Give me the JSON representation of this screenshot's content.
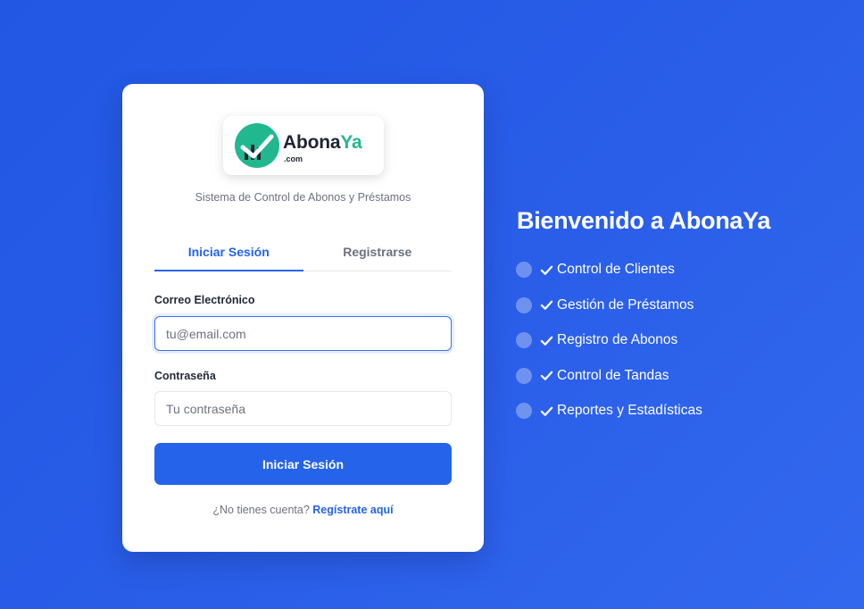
{
  "logo": {
    "name_main": "Abona",
    "name_accent": "Ya",
    "tld": ".com",
    "icon": "logo-chart-check-icon",
    "brand_color": "#22b88f"
  },
  "login": {
    "subtitle": "Sistema de Control de Abonos y Préstamos",
    "tabs": [
      {
        "label": "Iniciar Sesión",
        "active": true
      },
      {
        "label": "Registrarse",
        "active": false
      }
    ],
    "email": {
      "label": "Correo Electrónico",
      "placeholder": "tu@email.com",
      "value": ""
    },
    "password": {
      "label": "Contraseña",
      "placeholder": "Tu contraseña",
      "value": ""
    },
    "submit_label": "Iniciar Sesión",
    "signup_prompt": "¿No tienes cuenta?",
    "signup_link": "Regístrate aquí"
  },
  "welcome": {
    "title": "Bienvenido a AbonaYa",
    "features": [
      "Control de Clientes",
      "Gestión de Préstamos",
      "Registro de Abonos",
      "Control de Tandas",
      "Reportes y Estadísticas"
    ],
    "feature_icon": "check-icon"
  },
  "colors": {
    "background": "#2a5ee9",
    "accent": "#2563eb"
  }
}
